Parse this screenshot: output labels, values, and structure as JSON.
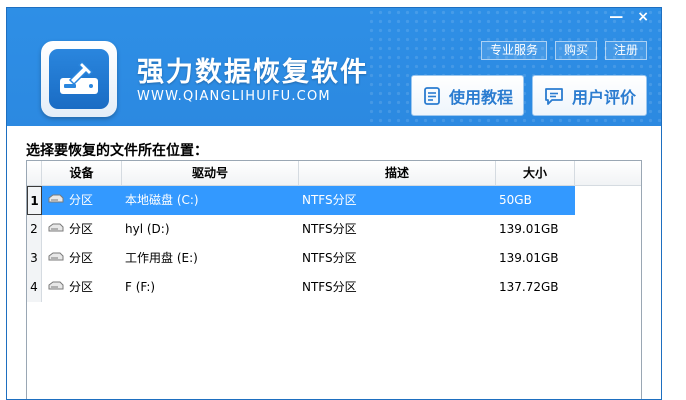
{
  "window": {
    "controls": {
      "minimize": "—",
      "close": "×"
    }
  },
  "header": {
    "title": "强力数据恢复软件",
    "url": "WWW.QIANGLIHUIFU.COM",
    "links": [
      "专业服务",
      "购买",
      "注册"
    ],
    "buttons": [
      {
        "label": "使用教程",
        "icon": "book-icon"
      },
      {
        "label": "用户评价",
        "icon": "chat-icon"
      }
    ]
  },
  "main": {
    "prompt": "选择要恢复的文件所在位置：",
    "table": {
      "columns": [
        "设备",
        "驱动号",
        "描述",
        "大小"
      ],
      "rows": [
        {
          "num": "1",
          "device": "分区",
          "drive": "本地磁盘 (C:)",
          "desc": "NTFS分区",
          "size": "50GB",
          "selected": true
        },
        {
          "num": "2",
          "device": "分区",
          "drive": "hyl (D:)",
          "desc": "NTFS分区",
          "size": "139.01GB",
          "selected": false
        },
        {
          "num": "3",
          "device": "分区",
          "drive": "工作用盘 (E:)",
          "desc": "NTFS分区",
          "size": "139.01GB",
          "selected": false
        },
        {
          "num": "4",
          "device": "分区",
          "drive": "F (F:)",
          "desc": "NTFS分区",
          "size": "137.72GB",
          "selected": false
        }
      ]
    }
  },
  "colors": {
    "header_blue": "#2b86de",
    "accent_blue": "#2b7cd0",
    "selection": "#3399ff"
  }
}
